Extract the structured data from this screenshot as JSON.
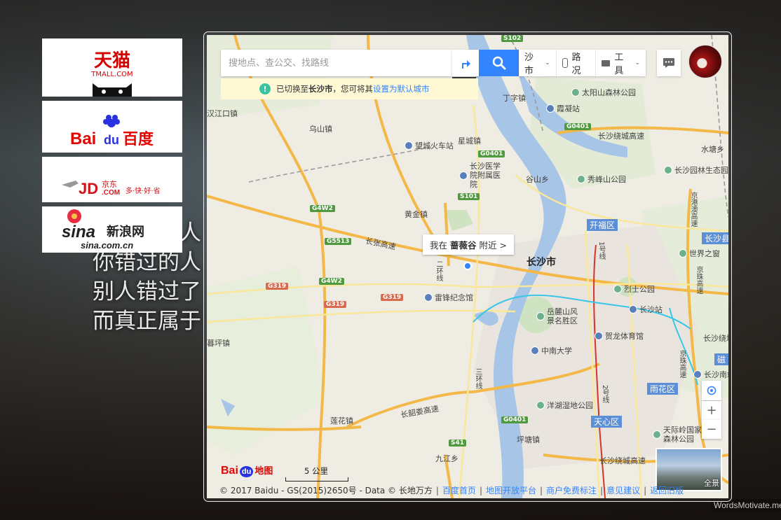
{
  "background": {
    "poem_lines": [
      "你错过的人",
      "你错过的人",
      "别人错过了",
      "而真正属于"
    ],
    "watermark": "WordsMotivate.me"
  },
  "ads": [
    {
      "name": "tmall",
      "title": "天猫",
      "subtitle": "TMALL.COM"
    },
    {
      "name": "baidu",
      "title": "Bai",
      "accent": "du",
      "cn": "百度"
    },
    {
      "name": "jd",
      "title": "JD",
      "accent": "京东",
      "sub": ".COM",
      "slogan": "多·快·好·省"
    },
    {
      "name": "sina",
      "title": "sina",
      "cn": "新浪网",
      "sub": "sina.com.cn"
    }
  ],
  "map": {
    "search": {
      "placeholder": "搜地点、查公交、找路线"
    },
    "route_tooltip": "路线",
    "notice": {
      "prefix": "已切换至",
      "city": "长沙市",
      "middle": "，您可将其",
      "link": "设置为默认城市"
    },
    "toolbar": {
      "city": "沙市",
      "traffic": "路况",
      "tools": "工具"
    },
    "locate_popup": {
      "prefix": "我在",
      "place": "蔷薇谷",
      "suffix": "附近 >"
    },
    "zoom_in": "+",
    "zoom_out": "−",
    "panorama_label": "全景",
    "scale": "5 公里",
    "logo": {
      "bai": "Bai",
      "du": "du",
      "cn": "地图"
    },
    "copyright": "© 2017 Baidu - GS(2015)2650号 - Data © 长地万方",
    "footer_links": [
      "百度首页",
      "地图开放平台",
      "商户免费标注",
      "意见建议",
      "返回旧版"
    ],
    "labels": {
      "city": "长沙市",
      "districts": [
        "开福区",
        "长沙县",
        "雨花区",
        "天心区",
        "磁"
      ],
      "towns": [
        "乌山镇",
        "星城镇",
        "谷山乡",
        "黄金镇",
        "丁字镇",
        "坪塘镇",
        "莲花镇",
        "九江乡",
        "水塘乡",
        "暮坪镇",
        "汉江口镇"
      ],
      "pois": [
        "太阳山森林公园",
        "霞凝站",
        "望城火车站",
        "长沙医学院附属医院",
        "秀峰山公园",
        "长沙园林生态园",
        "世界之窗",
        "烈士公园",
        "长沙站",
        "雷锋纪念馆",
        "岳麓山风景名胜区",
        "中南大学",
        "贺龙体育馆",
        "洋湖湿地公园",
        "天际岭国家森林公园",
        "长沙南站"
      ],
      "shields": [
        "S102",
        "G0401",
        "G0401",
        "S101",
        "G4W2",
        "G5513",
        "G4W2",
        "G319",
        "G319",
        "G319",
        "G0401",
        "S41"
      ],
      "roads": [
        "长张高速",
        "长沙绕城高速",
        "长沙绕城高速",
        "长韶娄高速",
        "长沙绕城高速",
        "京港澳高速",
        "京珠高速",
        "京珠高速"
      ],
      "metro": [
        "二环线",
        "三环线",
        "1号线",
        "2号线"
      ]
    }
  }
}
